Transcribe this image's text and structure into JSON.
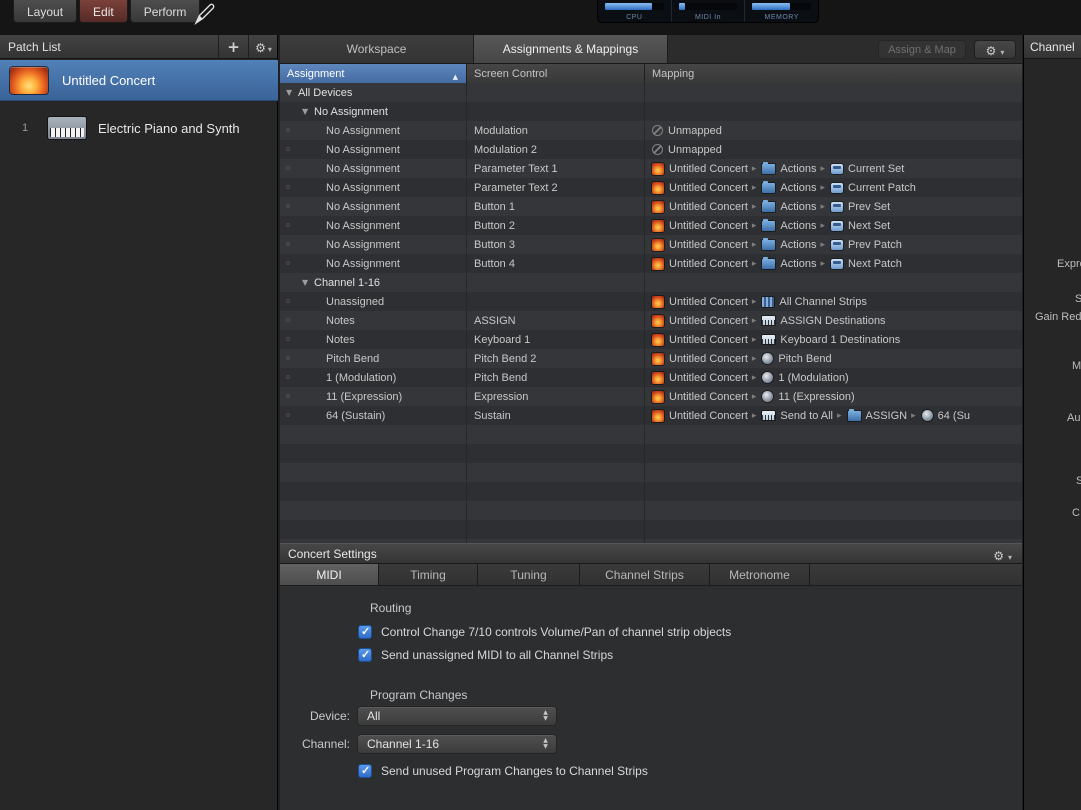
{
  "colors": {
    "selection_blue": "#4a77ad",
    "sorted_header_blue": "#4e7cb6",
    "checkbox_blue": "#3577d4",
    "concert_icon_orange": "#e06a28"
  },
  "toolbar": {
    "modes": [
      {
        "label": "Layout"
      },
      {
        "label": "Edit"
      },
      {
        "label": "Perform"
      }
    ],
    "selected_mode": "Edit",
    "meters": [
      {
        "label": "CPU",
        "fill_pct": 80
      },
      {
        "label": "MIDI In",
        "fill_pct": 10
      },
      {
        "label": "MEMORY",
        "fill_pct": 65
      }
    ]
  },
  "patch_list": {
    "title": "Patch List",
    "concert": {
      "name": "Untitled Concert"
    },
    "patches": [
      {
        "number": "1",
        "name": "Electric Piano and Synth"
      }
    ]
  },
  "main": {
    "tabs": [
      {
        "label": "Workspace"
      },
      {
        "label": "Assignments & Mappings"
      }
    ],
    "selected_tab": "Assignments & Mappings",
    "assign_map_button": "Assign & Map",
    "table": {
      "columns": [
        "Assignment",
        "Screen Control",
        "Mapping"
      ],
      "sort_column": "Assignment",
      "sort_ascending": true,
      "rows": [
        {
          "type": "group",
          "level": 0,
          "label": "All Devices"
        },
        {
          "type": "group",
          "level": 1,
          "label": "No Assignment"
        },
        {
          "type": "item",
          "assignment": "No Assignment",
          "screen_control": "Modulation",
          "mapping": [
            {
              "icon": "unmapped",
              "label": "Unmapped"
            }
          ]
        },
        {
          "type": "item",
          "assignment": "No Assignment",
          "screen_control": "Modulation 2",
          "mapping": [
            {
              "icon": "unmapped",
              "label": "Unmapped"
            }
          ]
        },
        {
          "type": "item",
          "assignment": "No Assignment",
          "screen_control": "Parameter Text 1",
          "mapping": [
            {
              "icon": "concert",
              "label": "Untitled Concert"
            },
            {
              "icon": "folder",
              "label": "Actions"
            },
            {
              "icon": "screen",
              "label": "Current Set"
            }
          ]
        },
        {
          "type": "item",
          "assignment": "No Assignment",
          "screen_control": "Parameter Text 2",
          "mapping": [
            {
              "icon": "concert",
              "label": "Untitled Concert"
            },
            {
              "icon": "folder",
              "label": "Actions"
            },
            {
              "icon": "screen",
              "label": "Current Patch"
            }
          ]
        },
        {
          "type": "item",
          "assignment": "No Assignment",
          "screen_control": "Button 1",
          "mapping": [
            {
              "icon": "concert",
              "label": "Untitled Concert"
            },
            {
              "icon": "folder",
              "label": "Actions"
            },
            {
              "icon": "screen",
              "label": "Prev Set"
            }
          ]
        },
        {
          "type": "item",
          "assignment": "No Assignment",
          "screen_control": "Button 2",
          "mapping": [
            {
              "icon": "concert",
              "label": "Untitled Concert"
            },
            {
              "icon": "folder",
              "label": "Actions"
            },
            {
              "icon": "screen",
              "label": "Next Set"
            }
          ]
        },
        {
          "type": "item",
          "assignment": "No Assignment",
          "screen_control": "Button 3",
          "mapping": [
            {
              "icon": "concert",
              "label": "Untitled Concert"
            },
            {
              "icon": "folder",
              "label": "Actions"
            },
            {
              "icon": "screen",
              "label": "Prev Patch"
            }
          ]
        },
        {
          "type": "item",
          "assignment": "No Assignment",
          "screen_control": "Button 4",
          "mapping": [
            {
              "icon": "concert",
              "label": "Untitled Concert"
            },
            {
              "icon": "folder",
              "label": "Actions"
            },
            {
              "icon": "screen",
              "label": "Next Patch"
            }
          ]
        },
        {
          "type": "group",
          "level": 1,
          "label": "Channel 1-16"
        },
        {
          "type": "item",
          "assignment": "Unassigned",
          "screen_control": "",
          "mapping": [
            {
              "icon": "concert",
              "label": "Untitled Concert"
            },
            {
              "icon": "strips",
              "label": "All Channel Strips"
            }
          ]
        },
        {
          "type": "item",
          "assignment": "Notes",
          "screen_control": "ASSIGN",
          "mapping": [
            {
              "icon": "concert",
              "label": "Untitled Concert"
            },
            {
              "icon": "kbd",
              "label": "ASSIGN Destinations"
            }
          ]
        },
        {
          "type": "item",
          "assignment": "Notes",
          "screen_control": "Keyboard 1",
          "mapping": [
            {
              "icon": "concert",
              "label": "Untitled Concert"
            },
            {
              "icon": "kbd",
              "label": "Keyboard 1 Destinations"
            }
          ]
        },
        {
          "type": "item",
          "assignment": "Pitch Bend",
          "screen_control": "Pitch Bend 2",
          "mapping": [
            {
              "icon": "concert",
              "label": "Untitled Concert"
            },
            {
              "icon": "knob",
              "label": "Pitch Bend"
            }
          ]
        },
        {
          "type": "item",
          "assignment": "1 (Modulation)",
          "screen_control": "Pitch Bend",
          "mapping": [
            {
              "icon": "concert",
              "label": "Untitled Concert"
            },
            {
              "icon": "knob",
              "label": "1 (Modulation)"
            }
          ]
        },
        {
          "type": "item",
          "assignment": "11 (Expression)",
          "screen_control": "Expression",
          "mapping": [
            {
              "icon": "concert",
              "label": "Untitled Concert"
            },
            {
              "icon": "knob",
              "label": "11 (Expression)"
            }
          ]
        },
        {
          "type": "item",
          "assignment": "64 (Sustain)",
          "screen_control": "Sustain",
          "mapping": [
            {
              "icon": "concert",
              "label": "Untitled Concert"
            },
            {
              "icon": "kbd",
              "label": "Send to All"
            },
            {
              "icon": "folder",
              "label": "ASSIGN"
            },
            {
              "icon": "knob",
              "label": "64 (Su"
            }
          ]
        }
      ]
    }
  },
  "concert_settings": {
    "title": "Concert Settings",
    "tabs": [
      "MIDI",
      "Timing",
      "Tuning",
      "Channel Strips",
      "Metronome"
    ],
    "selected_tab": "MIDI",
    "midi": {
      "routing_label": "Routing",
      "checkboxes": [
        {
          "label": "Control Change 7/10 controls Volume/Pan of channel strip objects",
          "checked": true
        },
        {
          "label": "Send unassigned MIDI to all Channel Strips",
          "checked": true
        }
      ],
      "program_changes_label": "Program Changes",
      "device_label": "Device:",
      "device_value": "All",
      "channel_label": "Channel:",
      "channel_value": "Channel 1-16",
      "send_unused_label": "Send unused Program Changes to Channel Strips",
      "send_unused_checked": true
    }
  },
  "right_panel": {
    "title": "Channel",
    "fragments": [
      "Expre",
      "S",
      "Gain Red",
      "M",
      "Au",
      "S",
      "C"
    ]
  }
}
